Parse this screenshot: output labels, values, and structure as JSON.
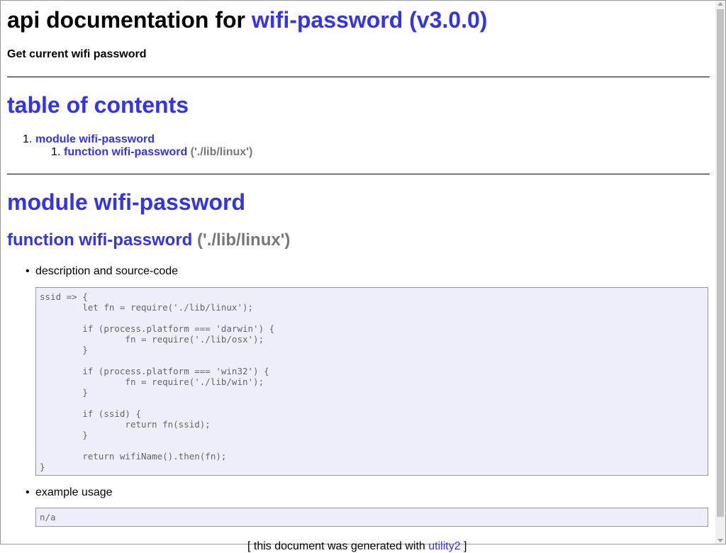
{
  "header": {
    "title_prefix": "api documentation for",
    "title_link": "wifi-password (v3.0.0)",
    "subtitle": "Get current wifi password"
  },
  "toc": {
    "heading": "table of contents",
    "items": [
      {
        "number": "1.",
        "label": "module wifi-password",
        "children": [
          {
            "number": "1.",
            "label": "function wifi-password",
            "path": "('./lib/linux')"
          }
        ]
      }
    ]
  },
  "module": {
    "heading": "module wifi-password",
    "function_heading": "function wifi-password",
    "function_path": "('./lib/linux')",
    "description_label": "description and source-code",
    "source_code": "ssid => {\n\tlet fn = require('./lib/linux');\n\n\tif (process.platform === 'darwin') {\n\t\tfn = require('./lib/osx');\n\t}\n\n\tif (process.platform === 'win32') {\n\t\tfn = require('./lib/win');\n\t}\n\n\tif (ssid) {\n\t\treturn fn(ssid);\n\t}\n\n\treturn wifiName().then(fn);\n}",
    "example_label": "example usage",
    "example_code": "n/a"
  },
  "footer": {
    "prefix": "[ this document was generated with ",
    "link": "utility2",
    "suffix": " ]"
  },
  "colors": {
    "link": "#3333ee",
    "code_background": "#eeeefa",
    "path_text": "#777777"
  }
}
